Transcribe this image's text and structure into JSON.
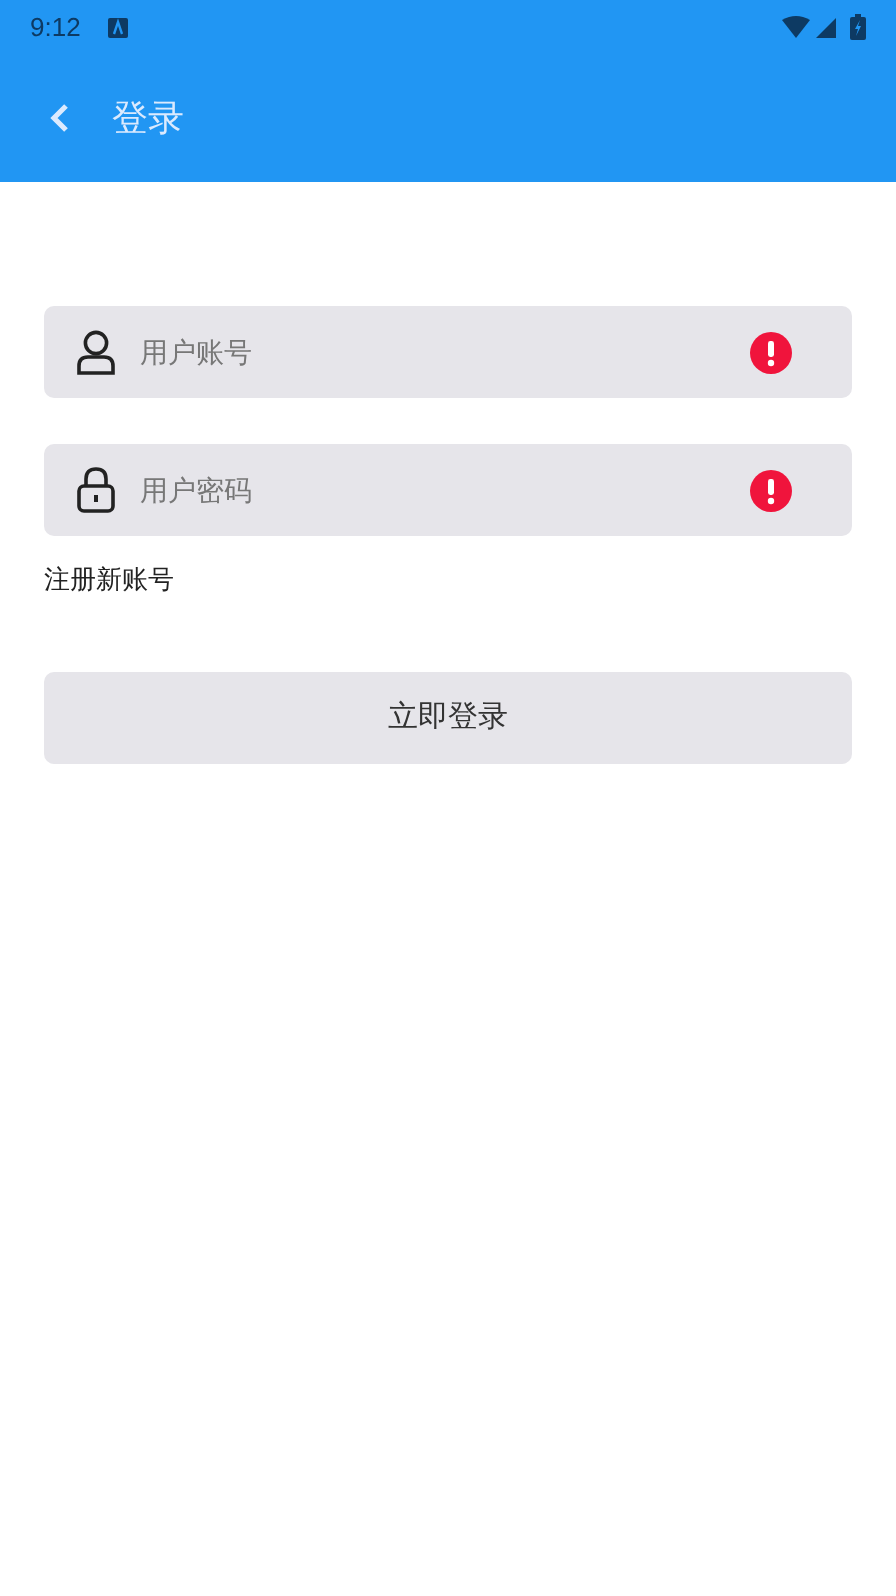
{
  "status_bar": {
    "time": "9:12"
  },
  "app_bar": {
    "title": "登录"
  },
  "fields": [
    {
      "kind": "user",
      "placeholder": "用户账号",
      "error": true
    },
    {
      "kind": "lock",
      "placeholder": "用户密码",
      "error": true
    }
  ],
  "register_link": "注册新账号",
  "login_button": "立即登录"
}
